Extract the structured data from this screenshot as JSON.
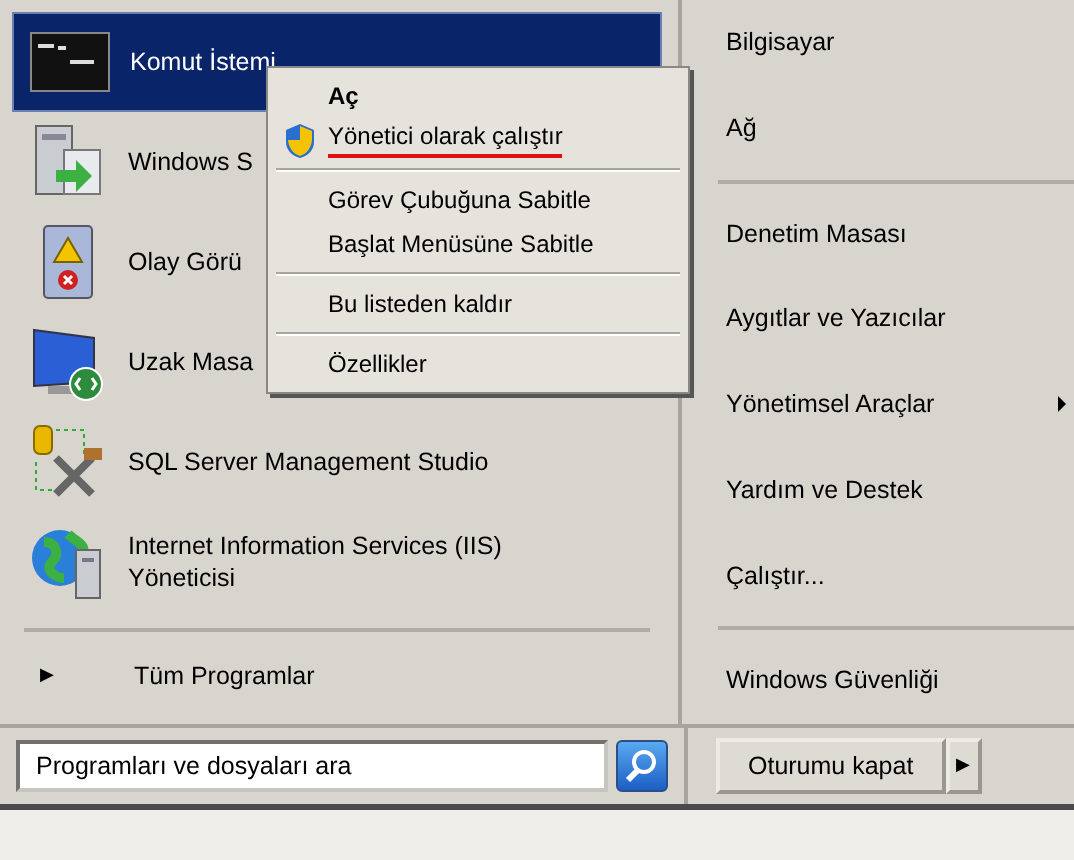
{
  "programs": [
    {
      "name": "Komut İstemi",
      "selected": true
    },
    {
      "name": "Windows S",
      "selected": false
    },
    {
      "name": "Olay Görü",
      "selected": false
    },
    {
      "name": "Uzak Masa",
      "selected": false
    },
    {
      "name": "SQL Server Management Studio",
      "selected": false
    },
    {
      "name": "Internet Information Services (IIS) Yöneticisi",
      "selected": false
    }
  ],
  "all_programs": {
    "arrow": "▶",
    "label": "Tüm Programlar"
  },
  "search": {
    "placeholder": "Programları ve dosyaları ara"
  },
  "places": [
    [
      {
        "label": "Bilgisayar",
        "has_submenu": false
      },
      {
        "label": "Ağ",
        "has_submenu": false
      }
    ],
    [
      {
        "label": "Denetim Masası",
        "has_submenu": false
      },
      {
        "label": "Aygıtlar ve Yazıcılar",
        "has_submenu": false
      },
      {
        "label": "Yönetimsel Araçlar",
        "has_submenu": true
      },
      {
        "label": "Yardım ve Destek",
        "has_submenu": false
      },
      {
        "label": "Çalıştır...",
        "has_submenu": false
      }
    ],
    [
      {
        "label": "Windows Güvenliği",
        "has_submenu": false
      }
    ]
  ],
  "shutdown": {
    "label": "Oturumu kapat",
    "arrow": "▶"
  },
  "context_menu": [
    [
      {
        "label": "Aç",
        "default": true,
        "shield": false,
        "underlined": false
      },
      {
        "label": "Yönetici olarak çalıştır",
        "default": false,
        "shield": true,
        "underlined": true
      }
    ],
    [
      {
        "label": "Görev Çubuğuna Sabitle",
        "default": false,
        "shield": false,
        "underlined": false
      },
      {
        "label": "Başlat Menüsüne Sabitle",
        "default": false,
        "shield": false,
        "underlined": false
      }
    ],
    [
      {
        "label": "Bu listeden kaldır",
        "default": false,
        "shield": false,
        "underlined": false
      }
    ],
    [
      {
        "label": "Özellikler",
        "default": false,
        "shield": false,
        "underlined": false
      }
    ]
  ]
}
